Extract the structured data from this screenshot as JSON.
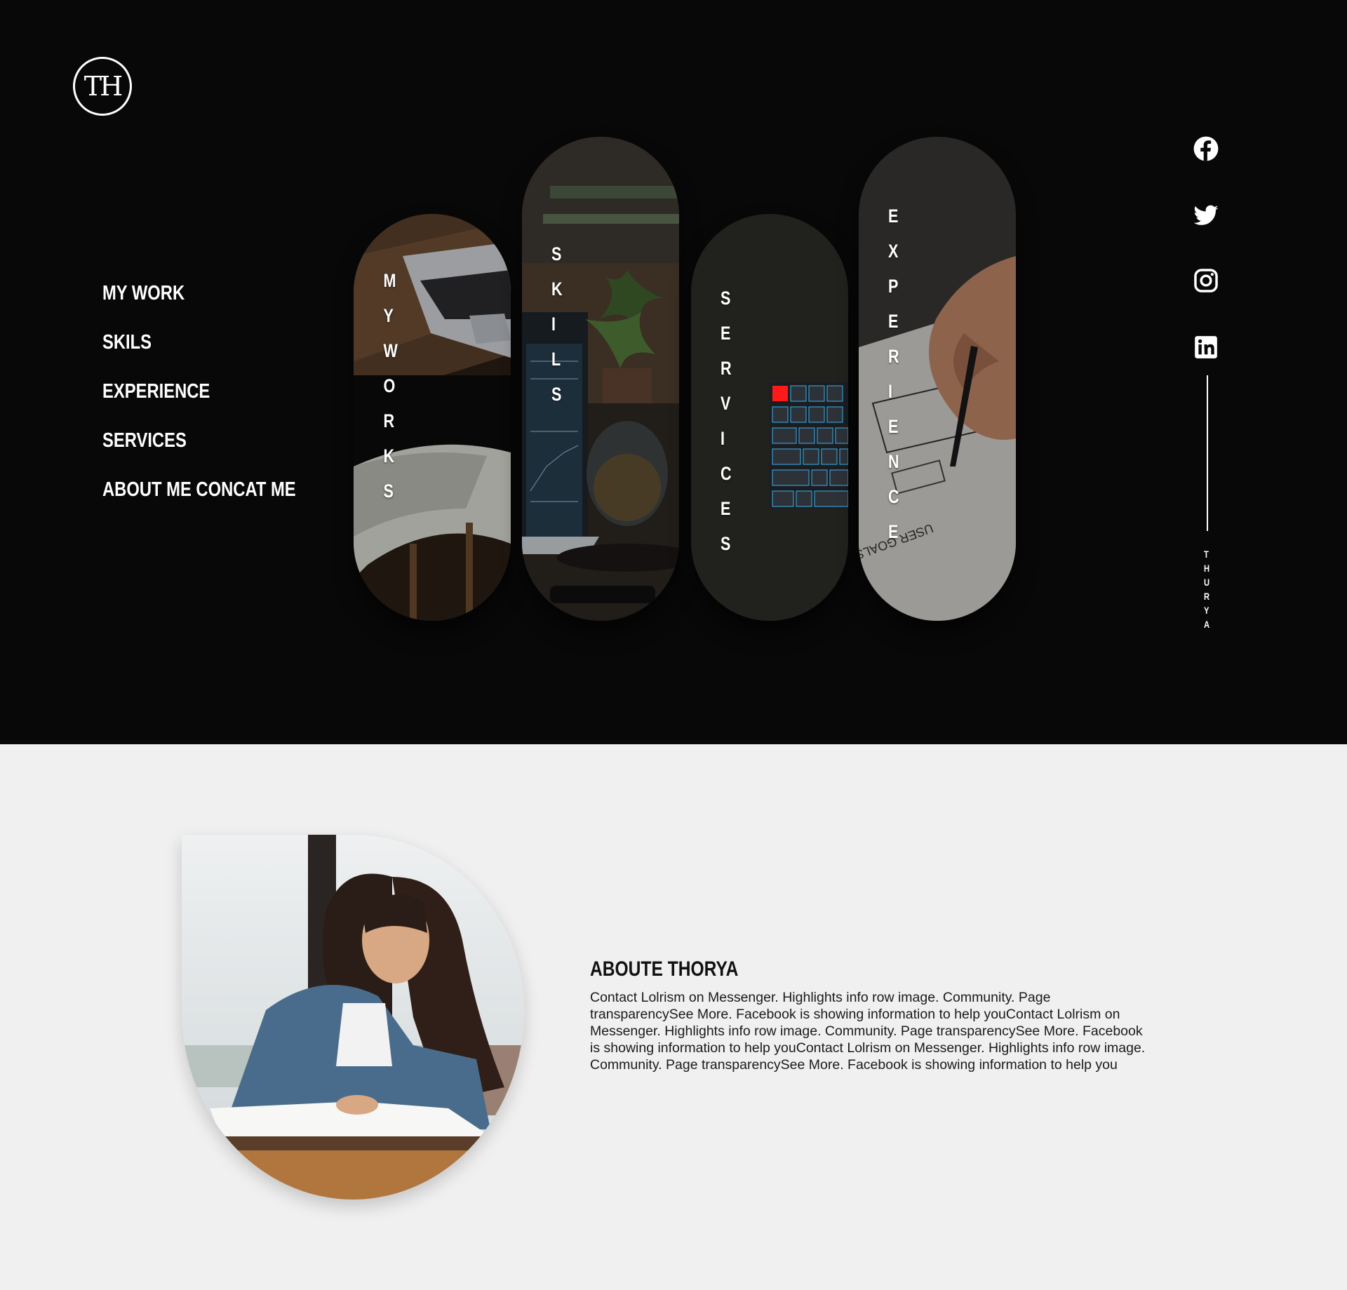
{
  "logo": {
    "text": "TH"
  },
  "nav": {
    "items": [
      {
        "label": "MY WORK"
      },
      {
        "label": "SKILS"
      },
      {
        "label": "EXPERIENCE"
      },
      {
        "label": "SERVICES"
      },
      {
        "label": "ABOUT ME CONCAT ME"
      }
    ]
  },
  "cards": [
    {
      "label": "MYWORKS",
      "letters": [
        "M",
        "Y",
        "W",
        "O",
        "R",
        "K",
        "S"
      ]
    },
    {
      "label": "SKILS",
      "letters": [
        "S",
        "K",
        "I",
        "L",
        "S"
      ]
    },
    {
      "label": "SERVICES",
      "letters": [
        "S",
        "E",
        "R",
        "V",
        "I",
        "C",
        "E",
        "S"
      ]
    },
    {
      "label": "EXPERIENCE",
      "letters": [
        "E",
        "X",
        "P",
        "E",
        "R",
        "I",
        "E",
        "N",
        "C",
        "E"
      ]
    }
  ],
  "social": [
    {
      "icon": "facebook-icon"
    },
    {
      "icon": "twitter-icon"
    },
    {
      "icon": "instagram-icon"
    },
    {
      "icon": "linkedin-icon"
    }
  ],
  "brand_vertical": [
    "T",
    "H",
    "U",
    "R",
    "Y",
    "A"
  ],
  "about": {
    "title": "ABOUTE THORYA",
    "text": "Contact Lolrism on Messenger. Highlights info row image. Community. Page transparencySee More. Facebook is showing information to help youContact Lolrism on Messenger. Highlights info row image. Community. Page transparencySee More. Facebook is showing information to help youContact Lolrism on Messenger. Highlights info row image. Community. Page transparencySee More. Facebook is showing information to help you"
  },
  "colors": {
    "hero_bg": "#080808",
    "page_bg": "#f0f0f0",
    "text_light": "#ffffff",
    "key_accent": "#ff1a1a"
  }
}
